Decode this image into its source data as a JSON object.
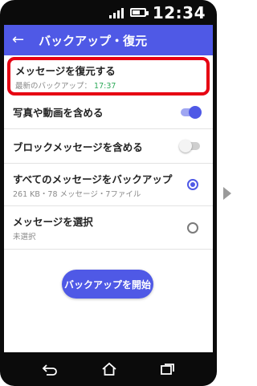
{
  "status_bar": {
    "time": "12:34"
  },
  "app_bar": {
    "back_icon": "arrow-left-icon",
    "title": "バックアップ・復元"
  },
  "items": {
    "restore": {
      "label": "メッセージを復元する",
      "sub_prefix": "最新のバックアップ：",
      "sub_time": "17:37"
    },
    "include_photos": {
      "label": "写真や動画を含める",
      "enabled": true
    },
    "include_blocked": {
      "label": "ブロックメッセージを含める",
      "enabled": false
    },
    "backup_all": {
      "label": "すべてのメッセージをバックアップ",
      "sub": "261 KB・78 メッセージ・7ファイル",
      "selected": true
    },
    "select_messages": {
      "label": "メッセージを選択",
      "sub": "未選択",
      "selected": false
    }
  },
  "start_button": {
    "label": "バックアップを開始"
  },
  "colors": {
    "accent": "#4f59e6",
    "highlight": "#e60012",
    "time_green": "#2eaa5a"
  },
  "nav_bar": {
    "icons": [
      "back-icon",
      "home-icon",
      "recents-icon"
    ]
  },
  "side_indicator": "next-arrow-icon"
}
